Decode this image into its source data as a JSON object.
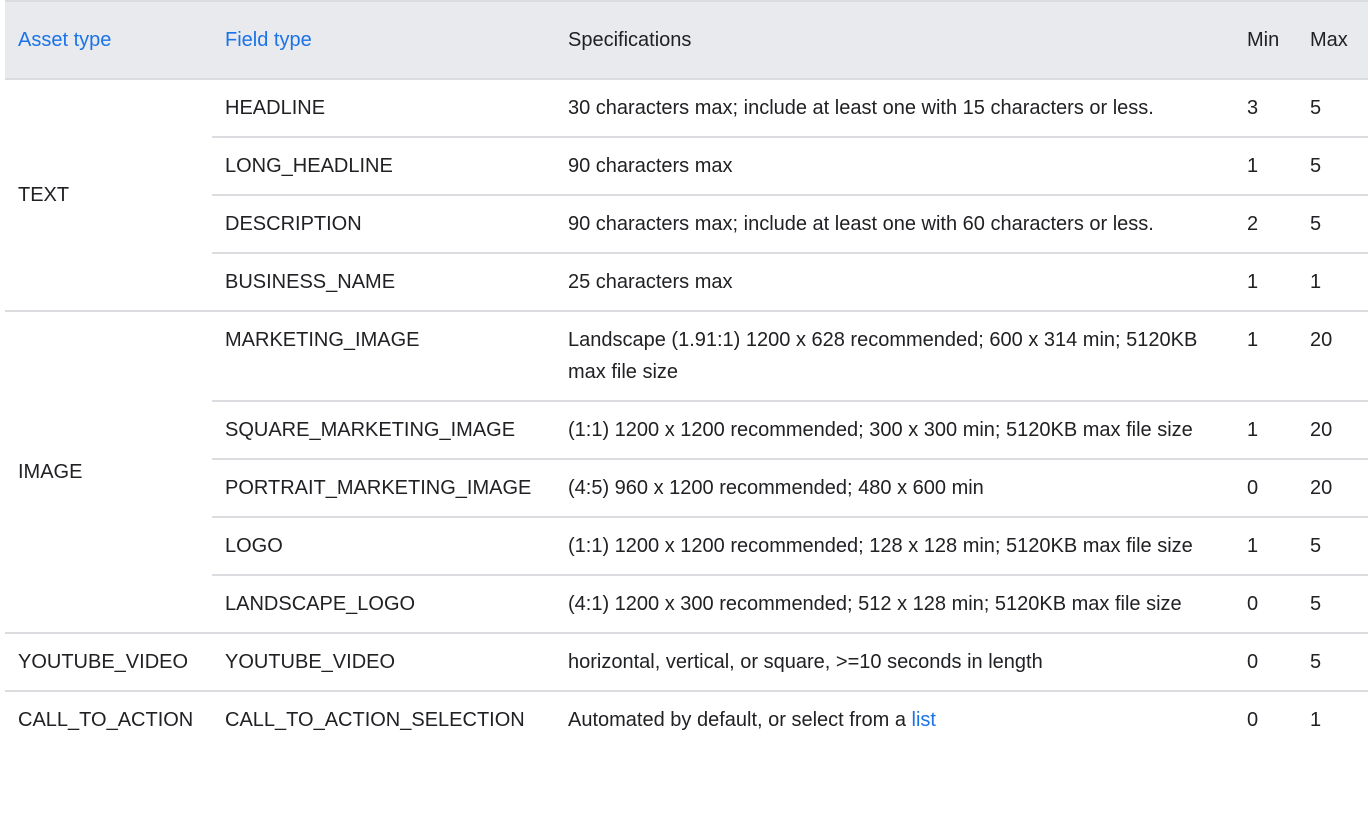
{
  "table": {
    "headers": {
      "asset_type": "Asset type",
      "field_type": "Field type",
      "specifications": "Specifications",
      "min": "Min",
      "max": "Max"
    },
    "groups": [
      {
        "asset_type": "TEXT",
        "rows": [
          {
            "field_type": "HEADLINE",
            "specification": "30 characters max; include at least one with 15 characters or less.",
            "min": "3",
            "max": "5"
          },
          {
            "field_type": "LONG_HEADLINE",
            "specification": "90 characters max",
            "min": "1",
            "max": "5"
          },
          {
            "field_type": "DESCRIPTION",
            "specification": "90 characters max; include at least one with 60 characters or less.",
            "min": "2",
            "max": "5"
          },
          {
            "field_type": "BUSINESS_NAME",
            "specification": "25 characters max",
            "min": "1",
            "max": "1"
          }
        ]
      },
      {
        "asset_type": "IMAGE",
        "rows": [
          {
            "field_type": "MARKETING_IMAGE",
            "specification": "Landscape (1.91:1) 1200 x 628 recommended; 600 x 314 min; 5120KB max file size",
            "min": "1",
            "max": "20"
          },
          {
            "field_type": "SQUARE_MARKETING_IMAGE",
            "specification": "(1:1) 1200 x 1200 recommended; 300 x 300 min; 5120KB max file size",
            "min": "1",
            "max": "20"
          },
          {
            "field_type": "PORTRAIT_MARKETING_IMAGE",
            "specification": "(4:5) 960 x 1200 recommended; 480 x 600 min",
            "min": "0",
            "max": "20"
          },
          {
            "field_type": "LOGO",
            "specification": "(1:1) 1200 x 1200 recommended; 128 x 128 min; 5120KB max file size",
            "min": "1",
            "max": "5"
          },
          {
            "field_type": "LANDSCAPE_LOGO",
            "specification": "(4:1) 1200 x 300 recommended; 512 x 128 min; 5120KB max file size",
            "min": "0",
            "max": "5"
          }
        ]
      },
      {
        "asset_type": "YOUTUBE_VIDEO",
        "rows": [
          {
            "field_type": "YOUTUBE_VIDEO",
            "specification": "horizontal, vertical, or square, >=10 seconds in length",
            "min": "0",
            "max": "5"
          }
        ]
      },
      {
        "asset_type": "CALL_TO_ACTION",
        "rows": [
          {
            "field_type": "CALL_TO_ACTION_SELECTION",
            "specification": "Automated by default, or select from a",
            "link_text": "list",
            "min": "0",
            "max": "1"
          }
        ]
      }
    ]
  },
  "colors": {
    "link": "#1a73e8",
    "header_bg": "#e8eaed",
    "border": "#dadce0",
    "text": "#202124"
  }
}
